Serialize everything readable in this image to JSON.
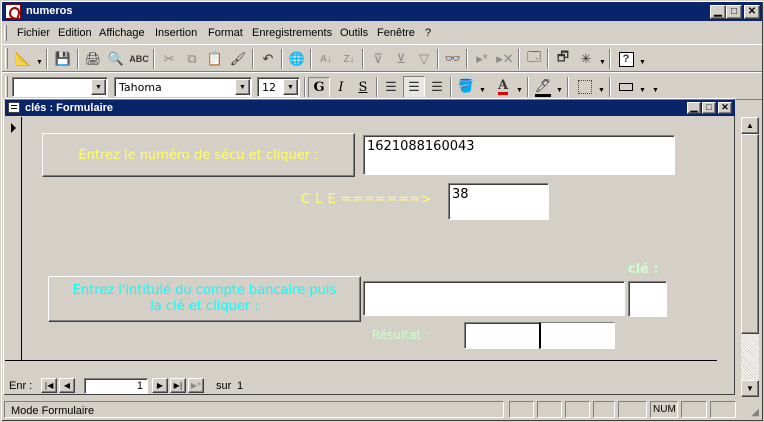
{
  "window": {
    "title": "numeros"
  },
  "menu": {
    "items": [
      {
        "label": "Fichier"
      },
      {
        "label": "Edition"
      },
      {
        "label": "Affichage"
      },
      {
        "label": "Insertion"
      },
      {
        "label": "Format"
      },
      {
        "label": "Enregistrements"
      },
      {
        "label": "Outils"
      },
      {
        "label": "Fenêtre"
      },
      {
        "label": "?"
      }
    ]
  },
  "formatting": {
    "object_combo": "",
    "font_name": "Tahoma",
    "font_size": "12",
    "bold_glyph": "G",
    "italic_glyph": "I",
    "underline_glyph": "S"
  },
  "form": {
    "title": "clés : Formulaire",
    "secu_button_label": "Entrez le numéro de sécu et cliquer :",
    "secu_value": "1621088160043",
    "cle_label": "C L E =======>",
    "cle_value": "38",
    "account_button_label": "Entrez l'intitulé du compte bancaire puis la clé et cliquer :",
    "account_value": "",
    "cle_small_label": "clé :",
    "cle_small_value": "",
    "result_label": "Résultat :",
    "result_value_left": "",
    "result_value_right": ""
  },
  "navigation": {
    "record_label": "Enr :",
    "current_record": "1",
    "of_label": "sur",
    "total_records": "1"
  },
  "status": {
    "mode_text": "Mode Formulaire",
    "num_indicator": "NUM"
  },
  "colors": {
    "title_bar": "#0a246a",
    "face": "#d4d0c8",
    "yellow_text": "#ffff66",
    "cyan_text": "#00ffff",
    "light_green_text": "#ccffcc"
  }
}
